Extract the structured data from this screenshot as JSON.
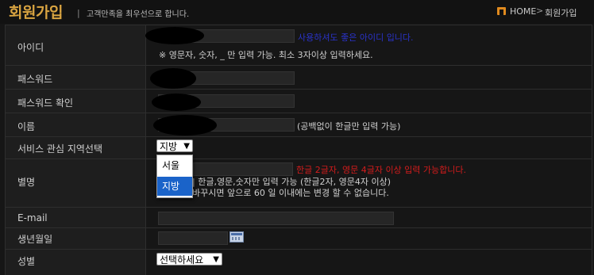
{
  "header": {
    "title": "회원가입",
    "separator": "|",
    "subtitle": "고객만족을 최우선으로 합니다.",
    "breadcrumb_home": "HOME",
    "breadcrumb_sep": ">",
    "breadcrumb_current": "회원가입"
  },
  "fields": {
    "id": {
      "label": "아이디",
      "status": "사용하셔도 좋은 아이디 입니다.",
      "note": "※ 영문자, 숫자, _ 만 입력 가능. 최소 3자이상 입력하세요."
    },
    "password": {
      "label": "패스워드"
    },
    "password_confirm": {
      "label": "패스워드 확인"
    },
    "name": {
      "label": "이름",
      "note": "(공백없이 한글만 입력 가능)"
    },
    "region": {
      "label": "서비스 관심 지역선택",
      "value": "지방",
      "options": [
        "서울",
        "지방"
      ]
    },
    "nickname": {
      "label": "별명",
      "warning": "한글 2글자, 영문 4글자 이상 입력 가능합니다.",
      "note1": "| 한글,영문,숫자만 입력 가능 (한글2자, 영문4자 이상)",
      "note2": "바꾸시면 앞으로 60 일 이내에는 변경 할 수 없습니다."
    },
    "email": {
      "label": "E-mail"
    },
    "birthdate": {
      "label": "생년월일"
    },
    "gender": {
      "label": "성별",
      "value": "선택하세요"
    }
  },
  "colors": {
    "title": "#d9a441",
    "home_icon": "#e08a1e",
    "status_ok": "#2a33c9",
    "warning": "#d31c1c",
    "selected_option": "#1a63c9"
  },
  "icons": [
    "home-icon",
    "calendar-icon",
    "chevron-down-icon"
  ]
}
